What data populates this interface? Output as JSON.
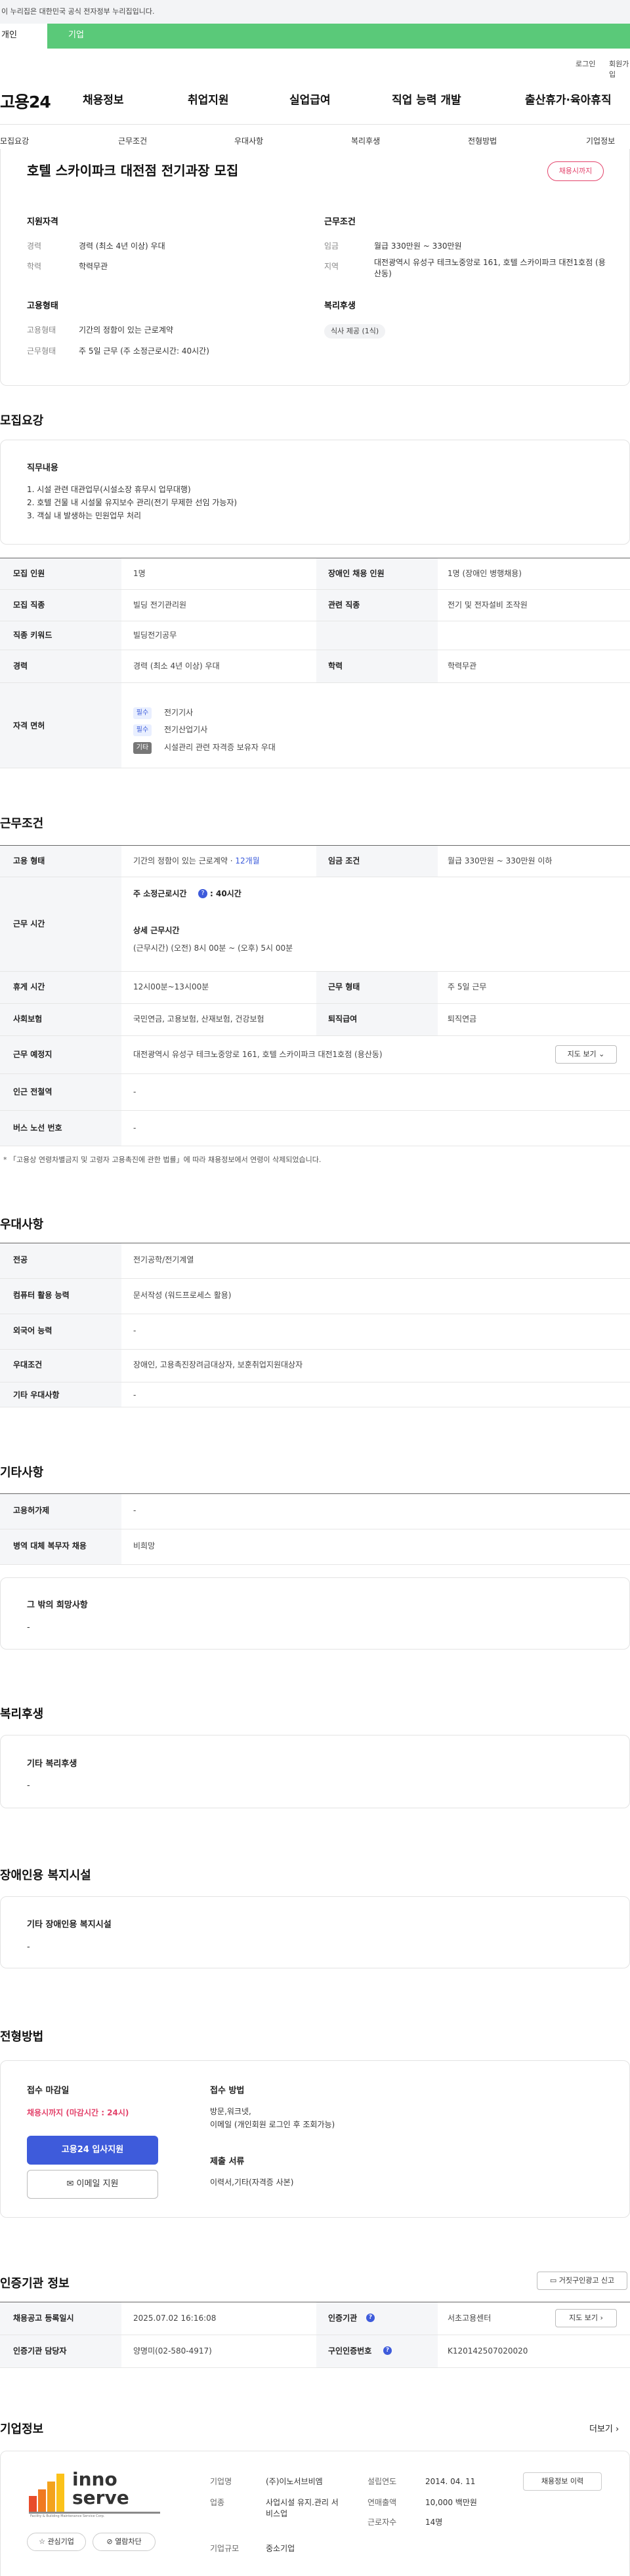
{
  "gov_banner": "이 누리집은 대한민국 공식 전자정부 누리집입니다.",
  "top_tabs": {
    "personal": "개인",
    "company": "기업"
  },
  "util_links": {
    "login": "로그인",
    "join": "회원가입"
  },
  "logo": "고용24",
  "gnb": [
    "채용정보",
    "취업지원",
    "실업급여",
    "직업 능력 개발",
    "출산휴가·육아휴직"
  ],
  "anchors": [
    "모집요강",
    "근무조건",
    "우대사항",
    "복리후생",
    "전형방법",
    "기업정보"
  ],
  "summary": {
    "title": "호텔 스카이파크 대전점 전기과장 모집",
    "status": "채용시까지",
    "qualifications": {
      "heading": "지원자격",
      "career_label": "경력",
      "career_value": "경력 (최소 4년 이상) 우대",
      "edu_label": "학력",
      "edu_value": "학력무관"
    },
    "conditions": {
      "heading": "근무조건",
      "wage_label": "임금",
      "wage_value": "월급 330만원 ~ 330만원",
      "region_label": "지역",
      "region_value": "대전광역시 유성구 테크노중앙로 161, 호텔 스카이파크 대전1호점 (용산동)"
    },
    "employment": {
      "heading": "고용형태",
      "type_label": "고용형태",
      "type_value": "기간의 정함이 있는 근로계약",
      "form_label": "근무형태",
      "form_value": "주 5일 근무 (주 소정근로시간: 40시간)"
    },
    "welfare": {
      "heading": "복리후생",
      "chip": "식사 제공 (1식)"
    }
  },
  "recruit": {
    "section_title": "모집요강",
    "duty": {
      "title": "직무내용",
      "lines": [
        "1. 시설 관련 대관업무(시설소장 휴무시 업무대행)",
        "2. 호텔 건물 내 시설물 유지보수 관리(전기 무제한 선임 가능자)",
        "3. 객실 내 발생하는 민원업무 처리"
      ]
    },
    "headcount_label": "모집 인원",
    "headcount_value": "1명",
    "disabled_label": "장애인 채용 인원",
    "disabled_value": "1명 (장애인 병행채용)",
    "job_label": "모집 직종",
    "job_value": "빌딩 전기관리원",
    "related_label": "관련 직종",
    "related_value": "전기 및 전자설비 조작원",
    "keyword_label": "직종 키워드",
    "keyword_value": "빌딩전기공무",
    "career_label": "경력",
    "career_value": "경력 (최소 4년 이상) 우대",
    "edu_label": "학력",
    "edu_value": "학력무관",
    "license_label": "자격 면허",
    "licenses": [
      {
        "tag": "필수",
        "name": "전기기사"
      },
      {
        "tag": "필수",
        "name": "전기산업기사"
      },
      {
        "tag": "기타",
        "name": "시설관리 관련 자격증 보유자 우대"
      }
    ]
  },
  "work": {
    "section_title": "근무조건",
    "type_label": "고용 형태",
    "type_value": "기간의 정함이 있는 근로계약 · ",
    "type_months": "12개월",
    "wage_label": "임금 조건",
    "wage_value": "월급 330만원 ~ 330만원 이하",
    "hours_label": "근무 시간",
    "weekly_hours_title": "주 소정근로시간",
    "weekly_hours_value": ": 40시간",
    "detail_title": "상세 근무시간",
    "detail_value": "(근무시간) (오전) 8시 00분 ~ (오후) 5시 00분",
    "break_label": "휴게 시간",
    "break_value": "12시00분~13시00분",
    "form_label": "근무 형태",
    "form_value": "주 5일 근무",
    "insurance_label": "사회보험",
    "insurance_value": "국민연금, 고용보험, 산재보험, 건강보험",
    "retire_label": "퇴직급여",
    "retire_value": "퇴직연금",
    "place_label": "근무 예정지",
    "place_value": "대전광역시 유성구 테크노중앙로 161, 호텔 스카이파크 대전1호점 (용산동)",
    "map_button": "지도 보기",
    "station_label": "인근 전철역",
    "station_value": "-",
    "bus_label": "버스 노선 번호",
    "bus_value": "-",
    "note": "* 「고용상 연령차별금지 및 고령자 고용촉진에 관한 법률」에 따라 채용정보에서 연령이 삭제되었습니다."
  },
  "pref": {
    "section_title": "우대사항",
    "major_label": "전공",
    "major_value": "전기공학/전기계열",
    "computer_label": "컴퓨터 활용 능력",
    "computer_value": "문서작성 (워드프로세스 활용)",
    "language_label": "외국어 능력",
    "language_value": "-",
    "cond_label": "우대조건",
    "cond_value": "장애인, 고용촉진장려금대상자, 보훈취업지원대상자",
    "etc_label": "기타 우대사항",
    "etc_value": "-"
  },
  "other": {
    "section_title": "기타사항",
    "permit_label": "고용허가제",
    "permit_value": "-",
    "military_label": "병역 대체 복무자 채용",
    "military_value": "비희망",
    "hope_title": "그 밖의 희망사항",
    "hope_value": "-"
  },
  "welfare": {
    "section_title": "복리후생",
    "box_title": "기타 복리후생",
    "box_value": "-"
  },
  "facility": {
    "section_title": "장애인용 복지시설",
    "box_title": "기타 장애인용 복지시설",
    "box_value": "-"
  },
  "apply": {
    "section_title": "전형방법",
    "deadline_title": "접수 마감일",
    "deadline_value": "채용시까지 (마감시간 : 24시)",
    "apply_button": "고용24 입사지원",
    "email_button": "이메일 지원",
    "method_title": "접수 방법",
    "method_lines": [
      "방문,워크넷,",
      "이메일 (개인회원 로그인 후 조회가능)"
    ],
    "docs_title": "제출 서류",
    "docs_value": "이력서,기타(자격증 사본)"
  },
  "cert": {
    "section_title": "인증기관 정보",
    "report_button": "거짓구인광고 신고",
    "registered_label": "채용공고 등록일시",
    "registered_value": "2025.07.02 16:16:08",
    "agency_label": "인증기관",
    "agency_value": "서초고용센터",
    "map_button": "지도 보기",
    "manager_label": "인증기관 담당자",
    "manager_value": "양명미(02-580-4917)",
    "number_label": "구인인증번호",
    "number_value": "K120142507020020"
  },
  "company": {
    "section_title": "기업정보",
    "more": "더보기",
    "logo_text_1": "inno",
    "logo_text_2": "serve",
    "logo_tagline": "Facility & Building Maintenance Service Corp.",
    "interest_button": "관심기업",
    "hide_button": "열람차단",
    "name_label": "기업명",
    "name_value": "(주)이노서브비엠",
    "industry_label": "업종",
    "industry_value": "사업시설 유지.관리 서비스업",
    "size_label": "기업규모",
    "size_value": "중소기업",
    "founded_label": "설립연도",
    "founded_value": "2014. 04. 11",
    "sales_label": "연매출액",
    "sales_value": "10,000 백만원",
    "employees_label": "근로자수",
    "employees_value": "14명",
    "history_button": "채용정보 이력"
  },
  "colors": {
    "accent_green": "#5ac979",
    "primary_blue": "#3e5bdb",
    "status_pink": "#e3436b",
    "deadline_red": "#e3436b"
  }
}
